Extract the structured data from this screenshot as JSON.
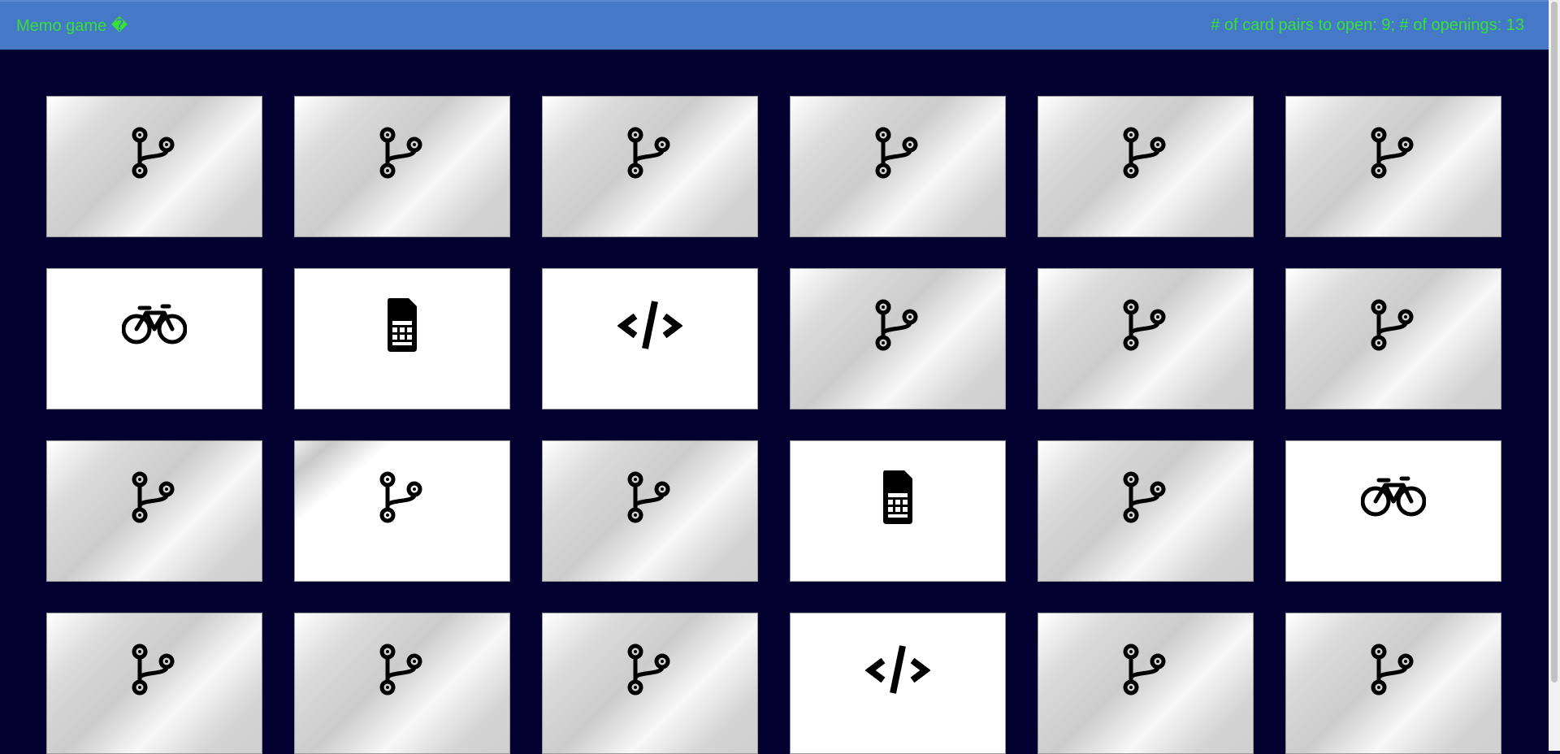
{
  "header": {
    "title": "Memo game �",
    "stats": "# of card pairs to open: 9; # of openings: 13"
  },
  "board": {
    "columns": 6,
    "cards": [
      {
        "state": "closed",
        "icon": "git-branch-icon"
      },
      {
        "state": "closed",
        "icon": "git-branch-icon"
      },
      {
        "state": "closed",
        "icon": "git-branch-icon"
      },
      {
        "state": "closed",
        "icon": "git-branch-icon"
      },
      {
        "state": "closed",
        "icon": "git-branch-icon"
      },
      {
        "state": "closed",
        "icon": "git-branch-icon"
      },
      {
        "state": "open",
        "icon": "bicycle-icon"
      },
      {
        "state": "open",
        "icon": "sim-card-icon"
      },
      {
        "state": "open",
        "icon": "code-icon"
      },
      {
        "state": "closed",
        "icon": "git-branch-icon"
      },
      {
        "state": "closed",
        "icon": "git-branch-icon"
      },
      {
        "state": "closed",
        "icon": "git-branch-icon"
      },
      {
        "state": "closed",
        "icon": "git-branch-icon"
      },
      {
        "state": "closed",
        "icon": "git-branch-icon",
        "shine": true
      },
      {
        "state": "closed",
        "icon": "git-branch-icon"
      },
      {
        "state": "open",
        "icon": "sim-card-icon"
      },
      {
        "state": "closed",
        "icon": "git-branch-icon"
      },
      {
        "state": "open",
        "icon": "bicycle-icon"
      },
      {
        "state": "closed",
        "icon": "git-branch-icon"
      },
      {
        "state": "closed",
        "icon": "git-branch-icon"
      },
      {
        "state": "closed",
        "icon": "git-branch-icon"
      },
      {
        "state": "open",
        "icon": "code-icon"
      },
      {
        "state": "closed",
        "icon": "git-branch-icon"
      },
      {
        "state": "closed",
        "icon": "git-branch-icon"
      }
    ]
  },
  "colors": {
    "background": "#02002f",
    "header": "#4678c8",
    "header_text": "#35e235",
    "card_open": "#ffffff"
  }
}
